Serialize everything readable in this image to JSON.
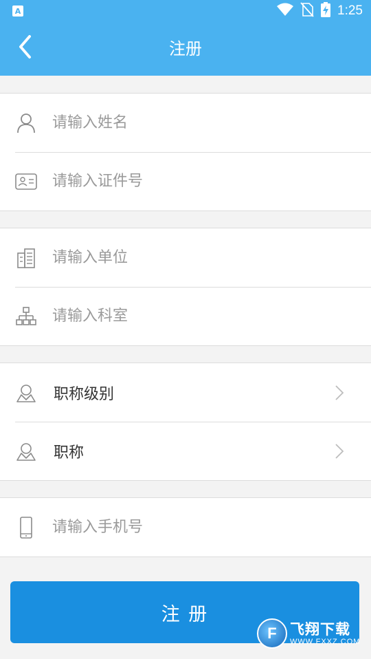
{
  "status_bar": {
    "app_badge": "A",
    "time": "1:25",
    "icons": [
      "wifi-icon",
      "no-sim-icon",
      "battery-charging-icon"
    ]
  },
  "header": {
    "title": "注册",
    "back_icon": "chevron-left-icon"
  },
  "groups": {
    "identity": {
      "name": {
        "placeholder": "请输入姓名",
        "icon": "person-icon"
      },
      "id_number": {
        "placeholder": "请输入证件号",
        "icon": "id-card-icon"
      }
    },
    "organization": {
      "unit": {
        "placeholder": "请输入单位",
        "icon": "building-icon"
      },
      "department": {
        "placeholder": "请输入科室",
        "icon": "org-chart-icon"
      }
    },
    "title": {
      "title_level": {
        "label": "职称级别",
        "icon": "user-badge-icon"
      },
      "title": {
        "label": "职称",
        "icon": "user-badge-icon"
      }
    },
    "contact": {
      "phone": {
        "placeholder": "请输入手机号",
        "icon": "phone-icon"
      }
    }
  },
  "submit": {
    "label": "注    册"
  },
  "watermark": {
    "main": "飞翔下载",
    "sub": "WWW.FXXZ.COM",
    "logo": "F"
  },
  "colors": {
    "primary": "#4ab2f0",
    "button": "#1a8fe0",
    "placeholder": "#9a9a9a",
    "divider": "#dcdcdc"
  }
}
